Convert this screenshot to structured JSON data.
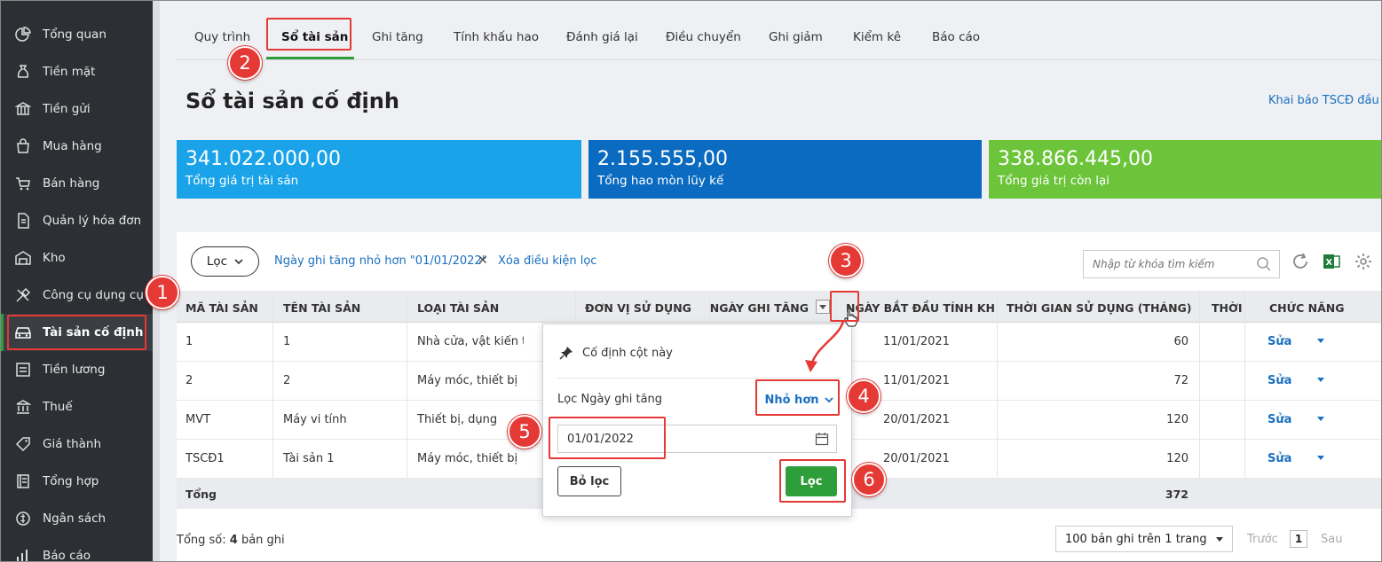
{
  "sidebar": {
    "items": [
      {
        "label": "Tổng quan",
        "icon": "pie-chart-icon"
      },
      {
        "label": "Tiền mặt",
        "icon": "money-bag-icon"
      },
      {
        "label": "Tiền gửi",
        "icon": "bank-icon"
      },
      {
        "label": "Mua hàng",
        "icon": "shopping-bag-icon"
      },
      {
        "label": "Bán hàng",
        "icon": "cart-icon"
      },
      {
        "label": "Quản lý hóa đơn",
        "icon": "invoice-icon"
      },
      {
        "label": "Kho",
        "icon": "warehouse-icon"
      },
      {
        "label": "Công cụ dụng cụ",
        "icon": "tools-icon"
      },
      {
        "label": "Tài sản cố định",
        "icon": "car-icon"
      },
      {
        "label": "Tiền lương",
        "icon": "payroll-icon"
      },
      {
        "label": "Thuế",
        "icon": "tax-icon"
      },
      {
        "label": "Giá thành",
        "icon": "price-tag-icon"
      },
      {
        "label": "Tổng hợp",
        "icon": "ledger-icon"
      },
      {
        "label": "Ngân sách",
        "icon": "budget-icon"
      },
      {
        "label": "Báo cáo",
        "icon": "report-icon"
      }
    ],
    "active_index": 8
  },
  "tabs": [
    "Quy trình",
    "Sổ tài sản",
    "Ghi tăng",
    "Tính khấu hao",
    "Đánh giá lại",
    "Điều chuyển",
    "Ghi giảm",
    "Kiểm kê",
    "Báo cáo"
  ],
  "page": {
    "title": "Sổ tài sản cố định",
    "top_link": "Khai báo TSCĐ đầu kỳ"
  },
  "cards": [
    {
      "value": "341.022.000,00",
      "caption": "Tổng giá trị tài sản",
      "color": "#1aa3e8"
    },
    {
      "value": "2.155.555,00",
      "caption": "Tổng hao mòn lũy kế",
      "color": "#0b6bc0"
    },
    {
      "value": "338.866.445,00",
      "caption": "Tổng giá trị còn lại",
      "color": "#6cc43a"
    }
  ],
  "toolbar": {
    "filter_button": "Lọc",
    "active_filter": "Ngày ghi tăng nhỏ hơn \"01/01/2022\"",
    "clear_filter": "Xóa điều kiện lọc",
    "search_placeholder": "Nhập từ khóa tìm kiếm"
  },
  "table": {
    "headers": [
      "MÃ TÀI SẢN",
      "TÊN TÀI SẢN",
      "LOẠI TÀI SẢN",
      "ĐƠN VỊ SỬ DỤNG",
      "NGÀY GHI TĂNG",
      "NGÀY BẮT ĐẦU TÍNH KH",
      "THỜI GIAN SỬ DỤNG (THÁNG)",
      "THỜI G",
      "CHỨC NĂNG"
    ],
    "rows": [
      {
        "code": "1",
        "name": "1",
        "type": "Nhà cửa, vật kiến trú",
        "start": "11/01/2021",
        "months": "60",
        "action": "Sửa"
      },
      {
        "code": "2",
        "name": "2",
        "type": "Máy móc, thiết bị",
        "start": "11/01/2021",
        "months": "72",
        "action": "Sửa"
      },
      {
        "code": "MVT",
        "name": "Máy vi tính",
        "type": "Thiết bị, dụng",
        "start": "20/01/2021",
        "months": "120",
        "action": "Sửa"
      },
      {
        "code": "TSCĐ1",
        "name": "Tài sản 1",
        "type": "Máy móc, thiết bị",
        "start": "20/01/2021",
        "months": "120",
        "action": "Sửa"
      }
    ],
    "footer_label": "Tổng",
    "footer_total": "372"
  },
  "pagination": {
    "total_prefix": "Tổng số: ",
    "total_count": "4",
    "total_suffix": " bản ghi",
    "page_size": "100 bản ghi trên 1 trang",
    "prev": "Trước",
    "current": "1",
    "next": "Sau"
  },
  "popup": {
    "pin_label": "Cố định cột này",
    "filter_label": "Lọc Ngày ghi tăng",
    "operator": "Nhỏ hơn",
    "date_value": "01/01/2022",
    "clear_button": "Bỏ lọc",
    "apply_button": "Lọc"
  },
  "steps": [
    "1",
    "2",
    "3",
    "4",
    "5",
    "6"
  ],
  "colors": {
    "accent_green": "#2e9e3a",
    "link_blue": "#1a6fc0",
    "highlight_red": "#e53935",
    "sidebar_bg": "#2c2f33"
  }
}
